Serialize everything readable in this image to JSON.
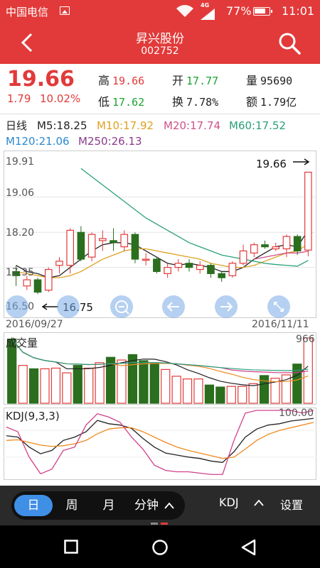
{
  "status_bar": {
    "carrier": "中国电信",
    "network": "4G",
    "battery": "77%",
    "time": "11:01"
  },
  "header": {
    "title": "昇兴股份",
    "code": "002752"
  },
  "quote": {
    "price": "19.66",
    "change": "1.79",
    "change_pct": "10.02%",
    "high_label": "高",
    "high": "19.66",
    "low_label": "低",
    "low": "17.62",
    "open_label": "开",
    "open": "17.77",
    "turnover_label": "换",
    "turnover": "7.78%",
    "volume_label": "量",
    "volume": "95690",
    "amount_label": "额",
    "amount": "1.79亿"
  },
  "ma_legend": {
    "period": "日线",
    "m5": "M5:18.25",
    "m10": "M10:17.92",
    "m20": "M20:17.74",
    "m60": "M60:17.52",
    "m120": "M120:21.06",
    "m250": "M250:26.13",
    "colors": {
      "m5": "#222222",
      "m10": "#e0a020",
      "m20": "#d0508a",
      "m60": "#2aa07a",
      "m120": "#2a8ad0",
      "m250": "#8a3a8a"
    }
  },
  "chart_data": [
    {
      "type": "candlestick",
      "y_ticks": [
        "19.91",
        "19.06",
        "18.20",
        "17.35",
        "16.50"
      ],
      "ylim": [
        16.5,
        19.91
      ],
      "start_date": "2016/09/27",
      "end_date": "2016/11/11",
      "max_annotation": "19.66",
      "min_annotation": "16.75",
      "up_color": "#e23a3a",
      "down_color": "#2a6e1e",
      "candles": [
        {
          "o": 17.25,
          "c": 17.15,
          "h": 17.4,
          "l": 16.9
        },
        {
          "o": 16.9,
          "c": 17.05,
          "h": 17.15,
          "l": 16.8
        },
        {
          "o": 17.05,
          "c": 16.75,
          "h": 17.1,
          "l": 16.7
        },
        {
          "o": 16.8,
          "c": 17.3,
          "h": 17.35,
          "l": 16.75
        },
        {
          "o": 17.4,
          "c": 17.5,
          "h": 17.6,
          "l": 17.2
        },
        {
          "o": 17.4,
          "c": 18.25,
          "h": 18.3,
          "l": 17.2
        },
        {
          "o": 18.2,
          "c": 17.55,
          "h": 18.35,
          "l": 17.5
        },
        {
          "o": 17.6,
          "c": 18.15,
          "h": 18.2,
          "l": 17.5
        },
        {
          "o": 18.0,
          "c": 18.05,
          "h": 18.25,
          "l": 17.75
        },
        {
          "o": 18.0,
          "c": 17.95,
          "h": 18.3,
          "l": 17.75
        },
        {
          "o": 17.85,
          "c": 18.15,
          "h": 18.25,
          "l": 17.75
        },
        {
          "o": 18.15,
          "c": 17.55,
          "h": 18.2,
          "l": 17.45
        },
        {
          "o": 17.55,
          "c": 17.55,
          "h": 17.7,
          "l": 17.4
        },
        {
          "o": 17.55,
          "c": 17.25,
          "h": 17.6,
          "l": 17.2
        },
        {
          "o": 17.2,
          "c": 17.35,
          "h": 17.45,
          "l": 17.1
        },
        {
          "o": 17.35,
          "c": 17.45,
          "h": 17.55,
          "l": 17.25
        },
        {
          "o": 17.45,
          "c": 17.35,
          "h": 17.55,
          "l": 17.25
        },
        {
          "o": 17.3,
          "c": 17.4,
          "h": 17.5,
          "l": 17.2
        },
        {
          "o": 17.4,
          "c": 17.2,
          "h": 17.45,
          "l": 17.1
        },
        {
          "o": 17.2,
          "c": 17.1,
          "h": 17.25,
          "l": 17.0
        },
        {
          "o": 17.15,
          "c": 17.45,
          "h": 17.5,
          "l": 17.1
        },
        {
          "o": 17.45,
          "c": 17.75,
          "h": 17.9,
          "l": 17.4
        },
        {
          "o": 17.7,
          "c": 17.9,
          "h": 17.95,
          "l": 17.6
        },
        {
          "o": 17.9,
          "c": 17.85,
          "h": 18.0,
          "l": 17.8
        },
        {
          "o": 17.8,
          "c": 17.85,
          "h": 17.95,
          "l": 17.75
        },
        {
          "o": 17.8,
          "c": 18.1,
          "h": 18.15,
          "l": 17.6
        },
        {
          "o": 18.1,
          "c": 17.75,
          "h": 18.15,
          "l": 17.65
        },
        {
          "o": 17.77,
          "c": 19.66,
          "h": 19.66,
          "l": 17.62
        }
      ],
      "ma_lines": {
        "m5": [
          17.4,
          17.25,
          17.2,
          17.1,
          17.15,
          17.35,
          17.55,
          17.75,
          17.9,
          17.95,
          17.95,
          17.9,
          17.75,
          17.6,
          17.45,
          17.4,
          17.45,
          17.4,
          17.35,
          17.25,
          17.25,
          17.35,
          17.55,
          17.7,
          17.85,
          17.9,
          17.85,
          18.25
        ],
        "m10": [
          17.25,
          17.2,
          17.15,
          17.1,
          17.1,
          17.15,
          17.25,
          17.4,
          17.55,
          17.65,
          17.75,
          17.8,
          17.8,
          17.75,
          17.7,
          17.65,
          17.6,
          17.55,
          17.45,
          17.4,
          17.35,
          17.35,
          17.4,
          17.5,
          17.6,
          17.7,
          17.75,
          17.92
        ],
        "m20": [
          null,
          null,
          null,
          null,
          null,
          null,
          null,
          null,
          null,
          null,
          null,
          null,
          null,
          null,
          null,
          null,
          null,
          null,
          null,
          null,
          null,
          null,
          17.55,
          17.6,
          17.65,
          17.7,
          17.7,
          17.74
        ],
        "m60": [
          null,
          null,
          null,
          null,
          null,
          null,
          19.75,
          19.55,
          19.35,
          19.15,
          18.95,
          18.75,
          18.55,
          18.4,
          18.25,
          18.1,
          17.95,
          17.85,
          17.75,
          17.65,
          17.6,
          17.55,
          17.5,
          17.45,
          17.42,
          17.4,
          17.38,
          17.52
        ]
      }
    },
    {
      "type": "bar",
      "title": "成交量",
      "max_label": "966",
      "values": [
        950,
        560,
        510,
        510,
        520,
        450,
        560,
        520,
        600,
        680,
        640,
        720,
        630,
        590,
        500,
        400,
        360,
        360,
        270,
        240,
        250,
        250,
        290,
        410,
        370,
        420,
        580,
        966
      ],
      "up": [
        false,
        true,
        false,
        true,
        true,
        true,
        false,
        true,
        true,
        false,
        true,
        false,
        false,
        false,
        true,
        true,
        true,
        true,
        false,
        false,
        true,
        true,
        true,
        false,
        true,
        true,
        false,
        true
      ]
    },
    {
      "type": "line",
      "title": "KDJ(9,3,3)",
      "max_label": "100.00",
      "ylim": [
        0,
        100
      ],
      "series": [
        {
          "name": "K",
          "color": "#222222",
          "values": [
            62,
            60,
            45,
            35,
            40,
            55,
            60,
            68,
            85,
            80,
            78,
            73,
            58,
            45,
            36,
            33,
            30,
            28,
            24,
            22,
            38,
            60,
            72,
            78,
            80,
            84,
            86,
            88
          ]
        },
        {
          "name": "D",
          "color": "#f08a20",
          "values": [
            55,
            56,
            52,
            48,
            46,
            47,
            50,
            55,
            65,
            72,
            74,
            74,
            68,
            60,
            52,
            45,
            40,
            36,
            32,
            28,
            30,
            42,
            55,
            64,
            70,
            74,
            78,
            82
          ]
        },
        {
          "name": "J",
          "color": "#d0408a",
          "values": [
            75,
            68,
            30,
            5,
            12,
            40,
            45,
            78,
            95,
            90,
            82,
            60,
            42,
            18,
            10,
            8,
            8,
            6,
            4,
            4,
            55,
            96,
            100,
            100,
            100,
            100,
            96,
            100
          ]
        }
      ]
    }
  ],
  "toolbar": {
    "tabs": [
      "日",
      "周",
      "月",
      "分钟"
    ],
    "active": "日",
    "indicator": "KDJ",
    "settings": "设置"
  }
}
